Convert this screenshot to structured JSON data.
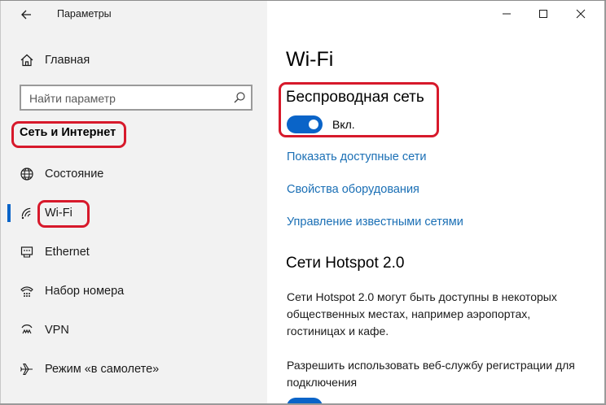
{
  "window": {
    "title": "Параметры",
    "controls": [
      "minimize-icon",
      "maximize-icon",
      "close-icon"
    ]
  },
  "sidebar": {
    "home_label": "Главная",
    "search_placeholder": "Найти параметр",
    "section_label": "Сеть и Интернет",
    "items": [
      {
        "label": "Состояние",
        "icon": "globe-icon"
      },
      {
        "label": "Wi-Fi",
        "icon": "wifi-icon",
        "active": true
      },
      {
        "label": "Ethernet",
        "icon": "ethernet-icon"
      },
      {
        "label": "Набор номера",
        "icon": "dialup-icon"
      },
      {
        "label": "VPN",
        "icon": "vpn-icon"
      },
      {
        "label": "Режим «в самолете»",
        "icon": "airplane-icon"
      }
    ]
  },
  "main": {
    "title": "Wi-Fi",
    "wireless_title": "Беспроводная сеть",
    "toggle_state": "Вкл.",
    "links": [
      "Показать доступные сети",
      "Свойства оборудования",
      "Управление известными сетями"
    ],
    "hotspot_title": "Сети Hotspot 2.0",
    "hotspot_desc": "Сети Hotspot 2.0 могут быть доступны в некоторых общественных местах, например аэропортах, гостиницах и кафе.",
    "registration_desc": "Разрешить использовать веб-службу регистрации для подключения"
  },
  "colors": {
    "accent": "#0a64c8",
    "link": "#1a6fb5",
    "highlight": "#d7192b",
    "sidebar_bg": "#f2f2f2"
  }
}
